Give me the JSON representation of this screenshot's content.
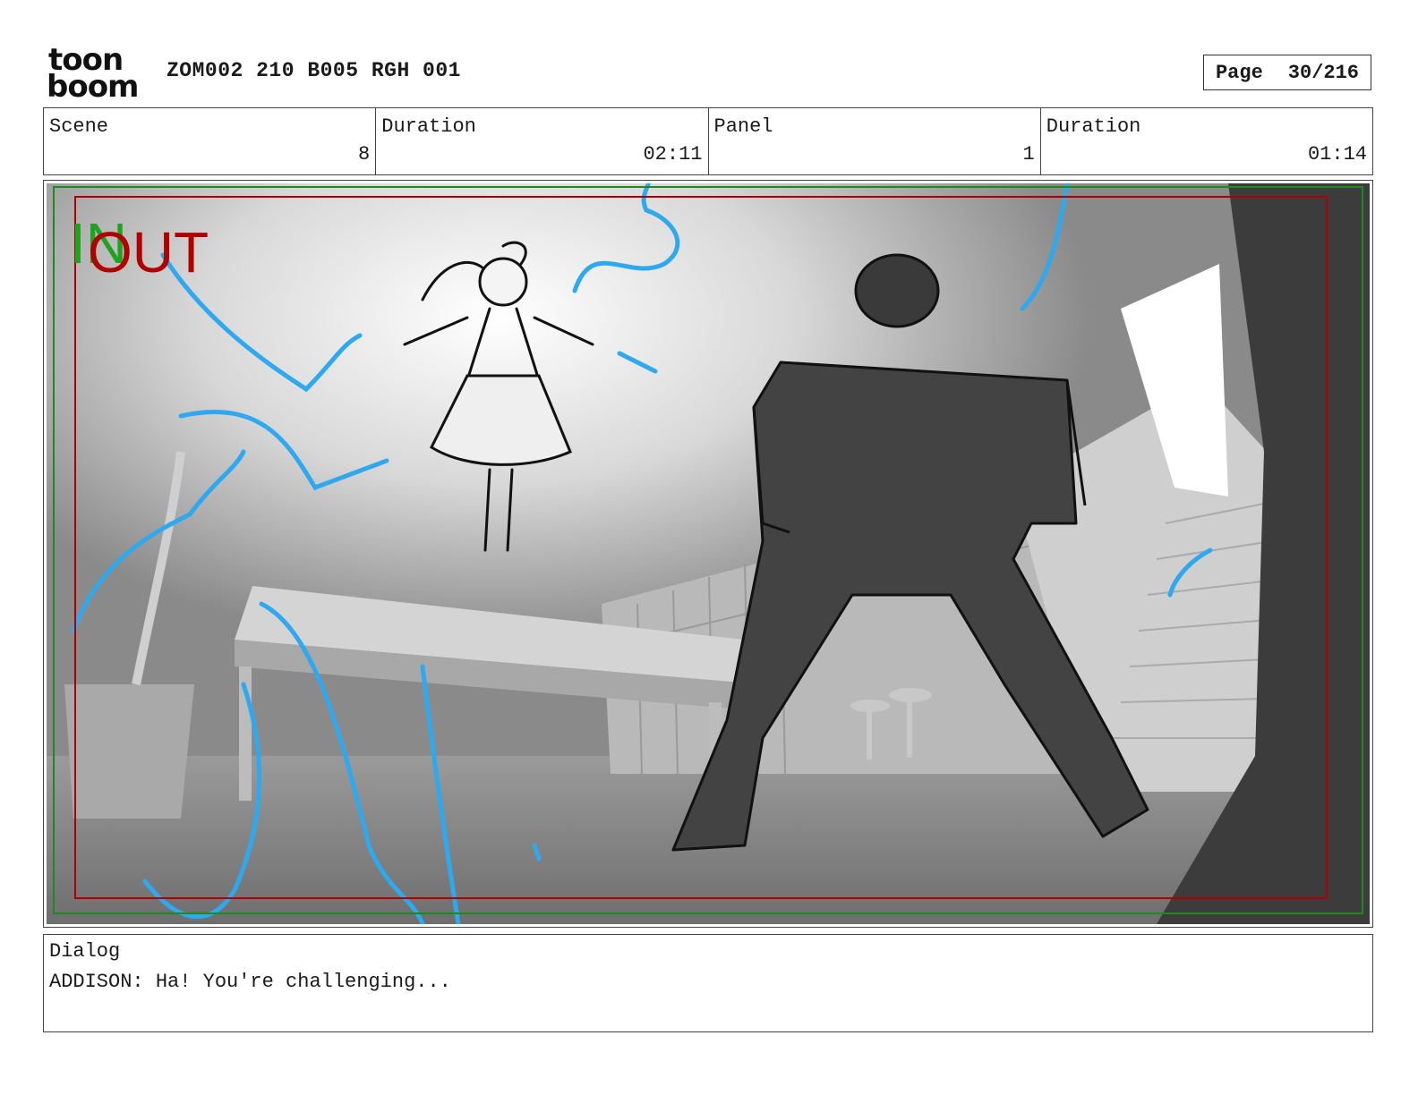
{
  "header": {
    "logo_text_top": "toon",
    "logo_text_bottom": "boom",
    "doc_title": "ZOM002 210 B005 RGH 001",
    "page_label": "Page",
    "page_value": "30/216"
  },
  "info": {
    "scene_label": "Scene",
    "scene_value": "8",
    "duration_label": "Duration",
    "duration_value": "02:11",
    "panel_label": "Panel",
    "panel_value": "1",
    "panel_duration_label": "Duration",
    "panel_duration_value": "01:14"
  },
  "panel": {
    "in_label": "IN",
    "out_label": "OUT"
  },
  "dialog": {
    "label": "Dialog",
    "text": "ADDISON: Ha! You're challenging..."
  },
  "colors": {
    "in_marker": "#1fa31f",
    "out_marker": "#b00000",
    "energy": "#2ea8ee"
  }
}
